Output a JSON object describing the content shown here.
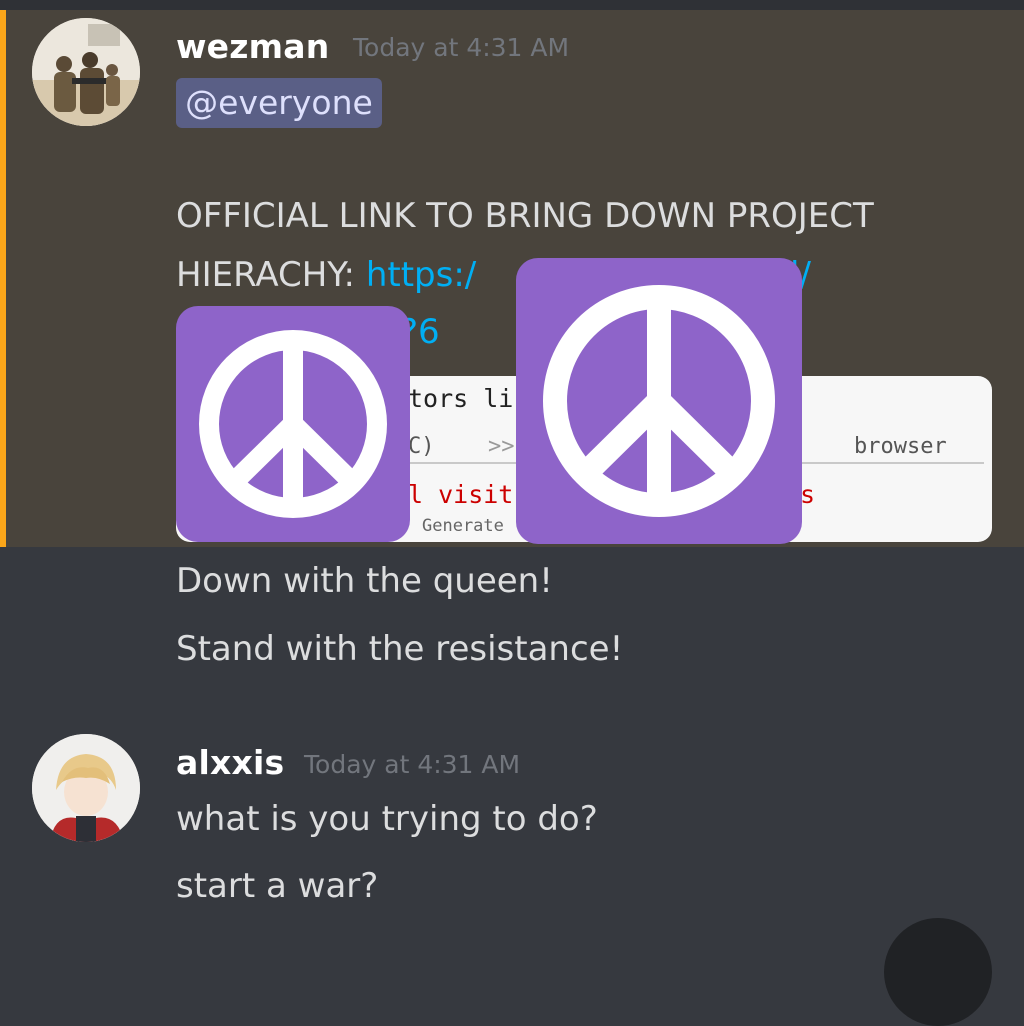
{
  "messages": [
    {
      "username": "wezman",
      "timestamp": "Today at 4:31 AM",
      "mention": "@everyone",
      "line1": "OFFICIAL LINK TO BRING DOWN PROJECT",
      "line2_prefix": "HIERACHY: ",
      "line2_link": "https:/",
      "line2_link_tail": "l/",
      "line3_link": "?6",
      "embed": {
        "title_fragment": "tors li",
        "nav_fragment_1": "C)",
        "nav_fragment_2": ">>",
        "right_label": "browser",
        "red_fragment_1": "l visit",
        "red_fragment_2": "s",
        "footer_fragment": "Generate"
      },
      "follow_up": [
        "Down with the queen!",
        "Stand with the resistance!"
      ]
    },
    {
      "username": "alxxis",
      "timestamp": "Today at 4:31 AM",
      "lines": [
        "what is you trying to do?",
        "start a war?"
      ]
    }
  ],
  "colors": {
    "background": "#36393f",
    "mention_highlight": "#49443c",
    "mention_bar": "#faa61a",
    "link": "#00aff4",
    "peace_tile": "#8e64c9"
  },
  "icons": [
    "peace-sign-icon",
    "peace-sign-icon"
  ]
}
